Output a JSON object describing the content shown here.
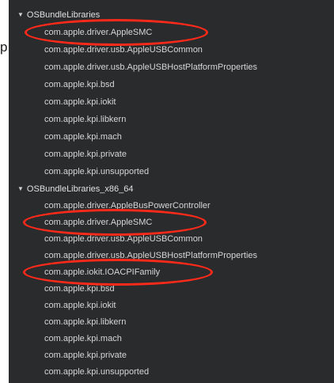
{
  "stray_text": "p",
  "groups": [
    {
      "label": "OSBundleLibraries",
      "items": [
        "com.apple.driver.AppleSMC",
        "com.apple.driver.usb.AppleUSBCommon",
        "com.apple.driver.usb.AppleUSBHostPlatformProperties",
        "com.apple.kpi.bsd",
        "com.apple.kpi.iokit",
        "com.apple.kpi.libkern",
        "com.apple.kpi.mach",
        "com.apple.kpi.private",
        "com.apple.kpi.unsupported"
      ]
    },
    {
      "label": "OSBundleLibraries_x86_64",
      "items": [
        "com.apple.driver.AppleBusPowerController",
        "com.apple.driver.AppleSMC",
        "com.apple.driver.usb.AppleUSBCommon",
        "com.apple.driver.usb.AppleUSBHostPlatformProperties",
        "com.apple.iokit.IOACPIFamily",
        "com.apple.kpi.bsd",
        "com.apple.kpi.iokit",
        "com.apple.kpi.libkern",
        "com.apple.kpi.mach",
        "com.apple.kpi.private",
        "com.apple.kpi.unsupported"
      ]
    }
  ],
  "disclosure_icon": "triangle-down-icon",
  "annotation_color": "#ff2a1a"
}
